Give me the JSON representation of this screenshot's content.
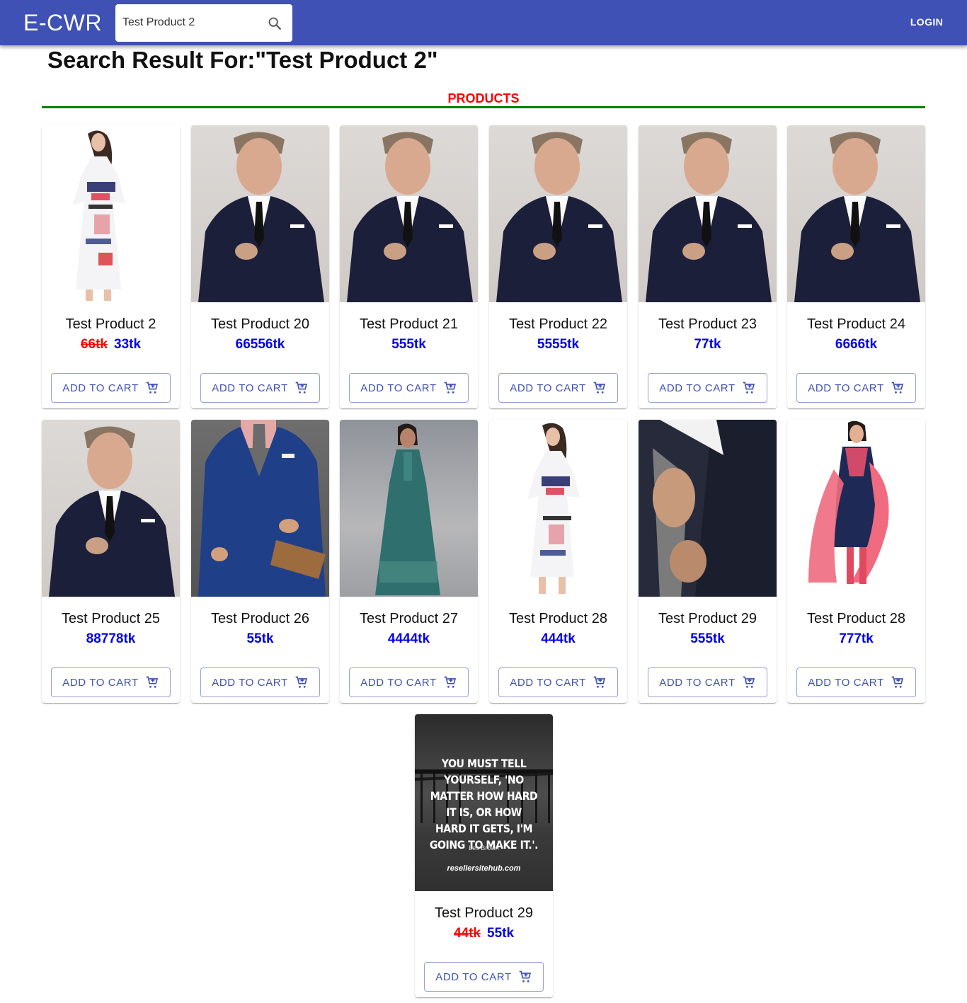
{
  "header": {
    "brand": "E-CWR",
    "search_value": "Test Product 2",
    "login_label": "LOGIN"
  },
  "page": {
    "result_title": "Search Result For:\"Test Product 2\"",
    "section_title": "PRODUCTS"
  },
  "colors": {
    "appbar": "#3f51b5",
    "section_title": "#ff0000",
    "section_rule": "#008000",
    "old_price": "#ff0000",
    "new_price": "#0000ee"
  },
  "cart_label": "ADD TO CART",
  "products": [
    {
      "name": "Test Product 2",
      "old_price": "66tk",
      "price": "33tk",
      "image": "woman-white-dress"
    },
    {
      "name": "Test Product 20",
      "price": "66556tk",
      "image": "man-navy-suit"
    },
    {
      "name": "Test Product 21",
      "price": "555tk",
      "image": "man-navy-suit"
    },
    {
      "name": "Test Product 22",
      "price": "5555tk",
      "image": "man-navy-suit"
    },
    {
      "name": "Test Product 23",
      "price": "77tk",
      "image": "man-navy-suit"
    },
    {
      "name": "Test Product 24",
      "price": "6666tk",
      "image": "man-navy-suit"
    },
    {
      "name": "Test Product 25",
      "price": "88778tk",
      "image": "man-navy-suit"
    },
    {
      "name": "Test Product 26",
      "price": "55tk",
      "image": "man-blue-suit"
    },
    {
      "name": "Test Product 27",
      "price": "4444tk",
      "image": "woman-teal-gown"
    },
    {
      "name": "Test Product 28",
      "price": "444tk",
      "image": "woman-white-dress"
    },
    {
      "name": "Test Product 29",
      "price": "555tk",
      "image": "suit-closeup"
    },
    {
      "name": "Test Product 28",
      "price": "777tk",
      "image": "woman-salwar"
    },
    {
      "name": "Test Product 29",
      "old_price": "44tk",
      "price": "55tk",
      "image": "quote-poster",
      "quote": {
        "text": "YOU MUST TELL YOURSELF, 'NO MATTER HOW HARD IT IS, OR HOW HARD IT GETS, I'M GOING TO MAKE IT.'.",
        "author": "Les Brown",
        "site": "resellersitehub.com"
      }
    }
  ]
}
